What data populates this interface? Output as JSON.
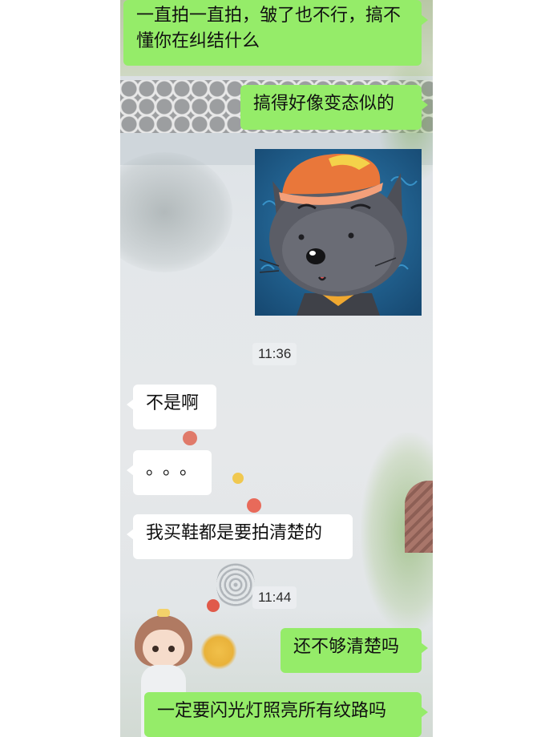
{
  "chat": {
    "messages": [
      {
        "direction": "outgoing",
        "text": "一直拍一直拍，皱了也不行，搞不懂你在纠结什么"
      },
      {
        "direction": "outgoing",
        "text": "搞得好像变态似的"
      },
      {
        "direction": "outgoing",
        "type": "sticker",
        "sticker": "grey-wolf-cartoon-sticker"
      },
      {
        "direction": "incoming",
        "text": "不是啊"
      },
      {
        "direction": "incoming",
        "text": "。。。"
      },
      {
        "direction": "incoming",
        "text": "我买鞋都是要拍清楚的"
      },
      {
        "direction": "outgoing",
        "text": "还不够清楚吗"
      },
      {
        "direction": "outgoing",
        "text": "一定要闪光灯照亮所有纹路吗"
      }
    ],
    "timestamps": [
      "11:36",
      "11:44"
    ]
  },
  "colors": {
    "outgoing_bubble": "#95ec69",
    "incoming_bubble": "#ffffff"
  }
}
